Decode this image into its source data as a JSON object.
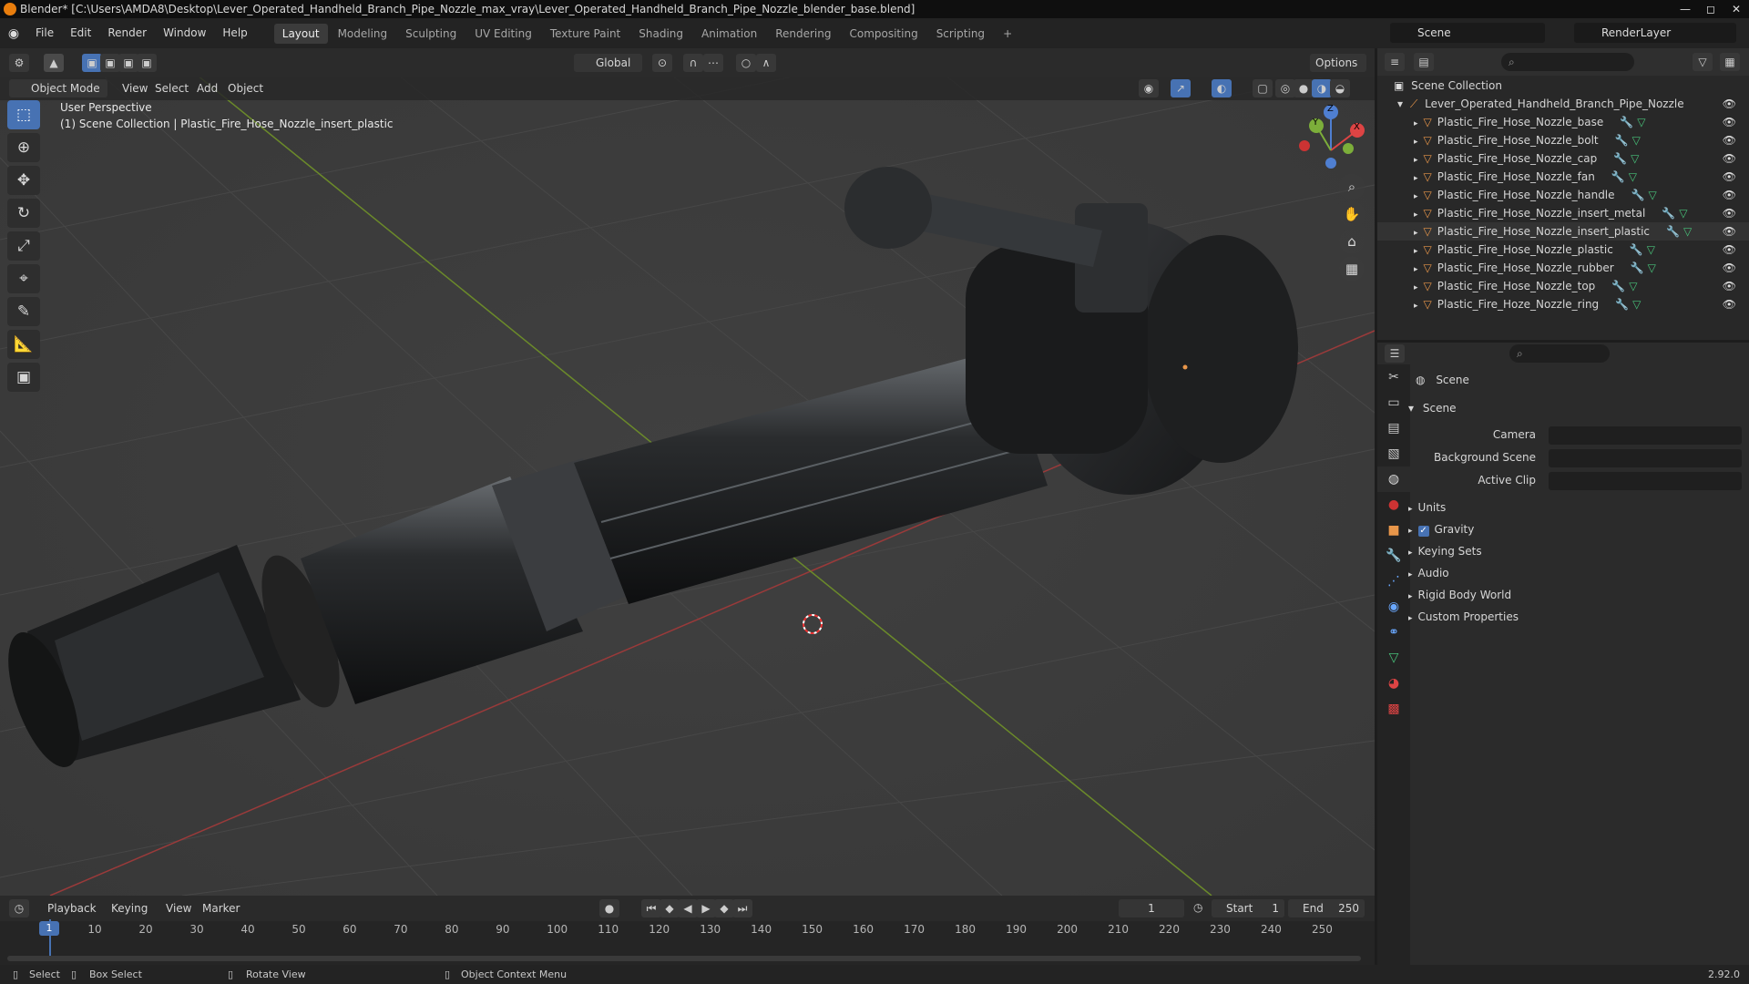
{
  "title_bar": {
    "title": "Blender* [C:\\Users\\AMDA8\\Desktop\\Lever_Operated_Handheld_Branch_Pipe_Nozzle_max_vray\\Lever_Operated_Handheld_Branch_Pipe_Nozzle_blender_base.blend]",
    "min": "—",
    "max": "◻",
    "close": "✕"
  },
  "menu": [
    "File",
    "Edit",
    "Render",
    "Window",
    "Help"
  ],
  "workspaces": [
    "Layout",
    "Modeling",
    "Sculpting",
    "UV Editing",
    "Texture Paint",
    "Shading",
    "Animation",
    "Rendering",
    "Compositing",
    "Scripting",
    "+"
  ],
  "scene": {
    "name": "Scene",
    "view_layer": "RenderLayer"
  },
  "viewport": {
    "mode": "Object Mode",
    "menus": [
      "View",
      "Select",
      "Add",
      "Object"
    ],
    "transform": "Global",
    "options": "Options",
    "perspective": "User Perspective",
    "collection_info": "(1) Scene Collection | Plastic_Fire_Hose_Nozzle_insert_plastic",
    "axis_x": "X",
    "axis_y": "Y",
    "axis_z": "Z"
  },
  "outliner": {
    "root": "Scene Collection",
    "parent": "Lever_Operated_Handheld_Branch_Pipe_Nozzle",
    "items": [
      "Plastic_Fire_Hose_Nozzle_base",
      "Plastic_Fire_Hose_Nozzle_bolt",
      "Plastic_Fire_Hose_Nozzle_cap",
      "Plastic_Fire_Hose_Nozzle_fan",
      "Plastic_Fire_Hose_Nozzle_handle",
      "Plastic_Fire_Hose_Nozzle_insert_metal",
      "Plastic_Fire_Hose_Nozzle_insert_plastic",
      "Plastic_Fire_Hose_Nozzle_plastic",
      "Plastic_Fire_Hose_Nozzle_rubber",
      "Plastic_Fire_Hose_Nozzle_top",
      "Plastic_Fire_Hoze_Nozzle_ring"
    ]
  },
  "properties": {
    "context": "Scene",
    "panel": "Scene",
    "fields": {
      "camera": "Camera",
      "background": "Background Scene",
      "clip": "Active Clip"
    },
    "sections": [
      "Units",
      "Gravity",
      "Keying Sets",
      "Audio",
      "Rigid Body World",
      "Custom Properties"
    ]
  },
  "timeline": {
    "menus": [
      "Playback",
      "Keying",
      "View",
      "Marker"
    ],
    "current": "1",
    "start_label": "Start",
    "start": "1",
    "end_label": "End",
    "end": "250",
    "ticks": [
      "1",
      "10",
      "20",
      "30",
      "40",
      "50",
      "60",
      "70",
      "80",
      "90",
      "100",
      "110",
      "120",
      "130",
      "140",
      "150",
      "160",
      "170",
      "180",
      "190",
      "200",
      "210",
      "220",
      "230",
      "240",
      "250"
    ]
  },
  "status": {
    "select": "Select",
    "box_select": "Box Select",
    "rotate": "Rotate View",
    "context_menu": "Object Context Menu",
    "version": "2.92.0"
  }
}
